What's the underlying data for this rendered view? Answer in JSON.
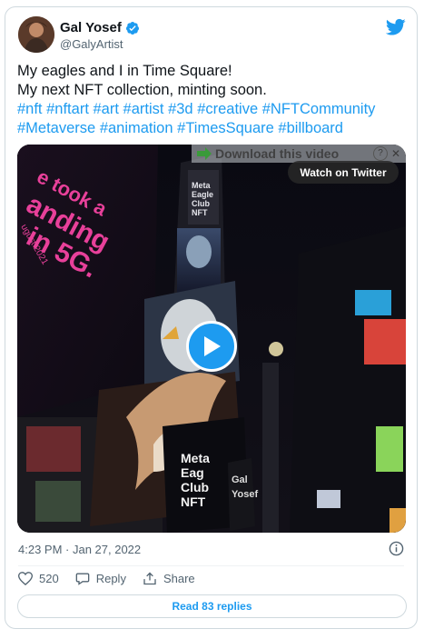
{
  "author": {
    "name": "Gal Yosef",
    "handle": "@GalyArtist",
    "verified": true
  },
  "tweet": {
    "lines": [
      "My eagles and I in Time Square!",
      "My next NFT collection, minting soon."
    ],
    "hashtag_lines": [
      [
        "#nft",
        "#nftart",
        "#art",
        "#artist",
        "#3d",
        "#creative",
        "#NFTCommunity"
      ],
      [
        "#Metaverse",
        "#animation",
        "#TimesSquare",
        "#billboard"
      ]
    ]
  },
  "media": {
    "download_label": "Download this video",
    "help_glyph": "?",
    "close_glyph": "✕",
    "watch_label": "Watch on Twitter",
    "billboard_texts": {
      "left_line1": "e took a",
      "left_line2": "anding",
      "left_line3": "in 5G.",
      "left_date": "ugust 2021",
      "tower1": "Meta",
      "tower2": "Eagle",
      "tower3": "Club",
      "tower4": "NFT",
      "bottom1": "Meta",
      "bottom2": "Eag",
      "bottom3": "Club",
      "bottom4": "NFT",
      "side1": "Gal",
      "side2": "Yosef"
    }
  },
  "meta": {
    "timestamp": "4:23 PM · Jan 27, 2022"
  },
  "actions": {
    "likes": "520",
    "reply_label": "Reply",
    "share_label": "Share"
  },
  "read_replies_label": "Read 83 replies",
  "colors": {
    "accent": "#1d9bf0",
    "text": "#0f1419",
    "muted": "#536471",
    "border": "#cfd9de"
  }
}
